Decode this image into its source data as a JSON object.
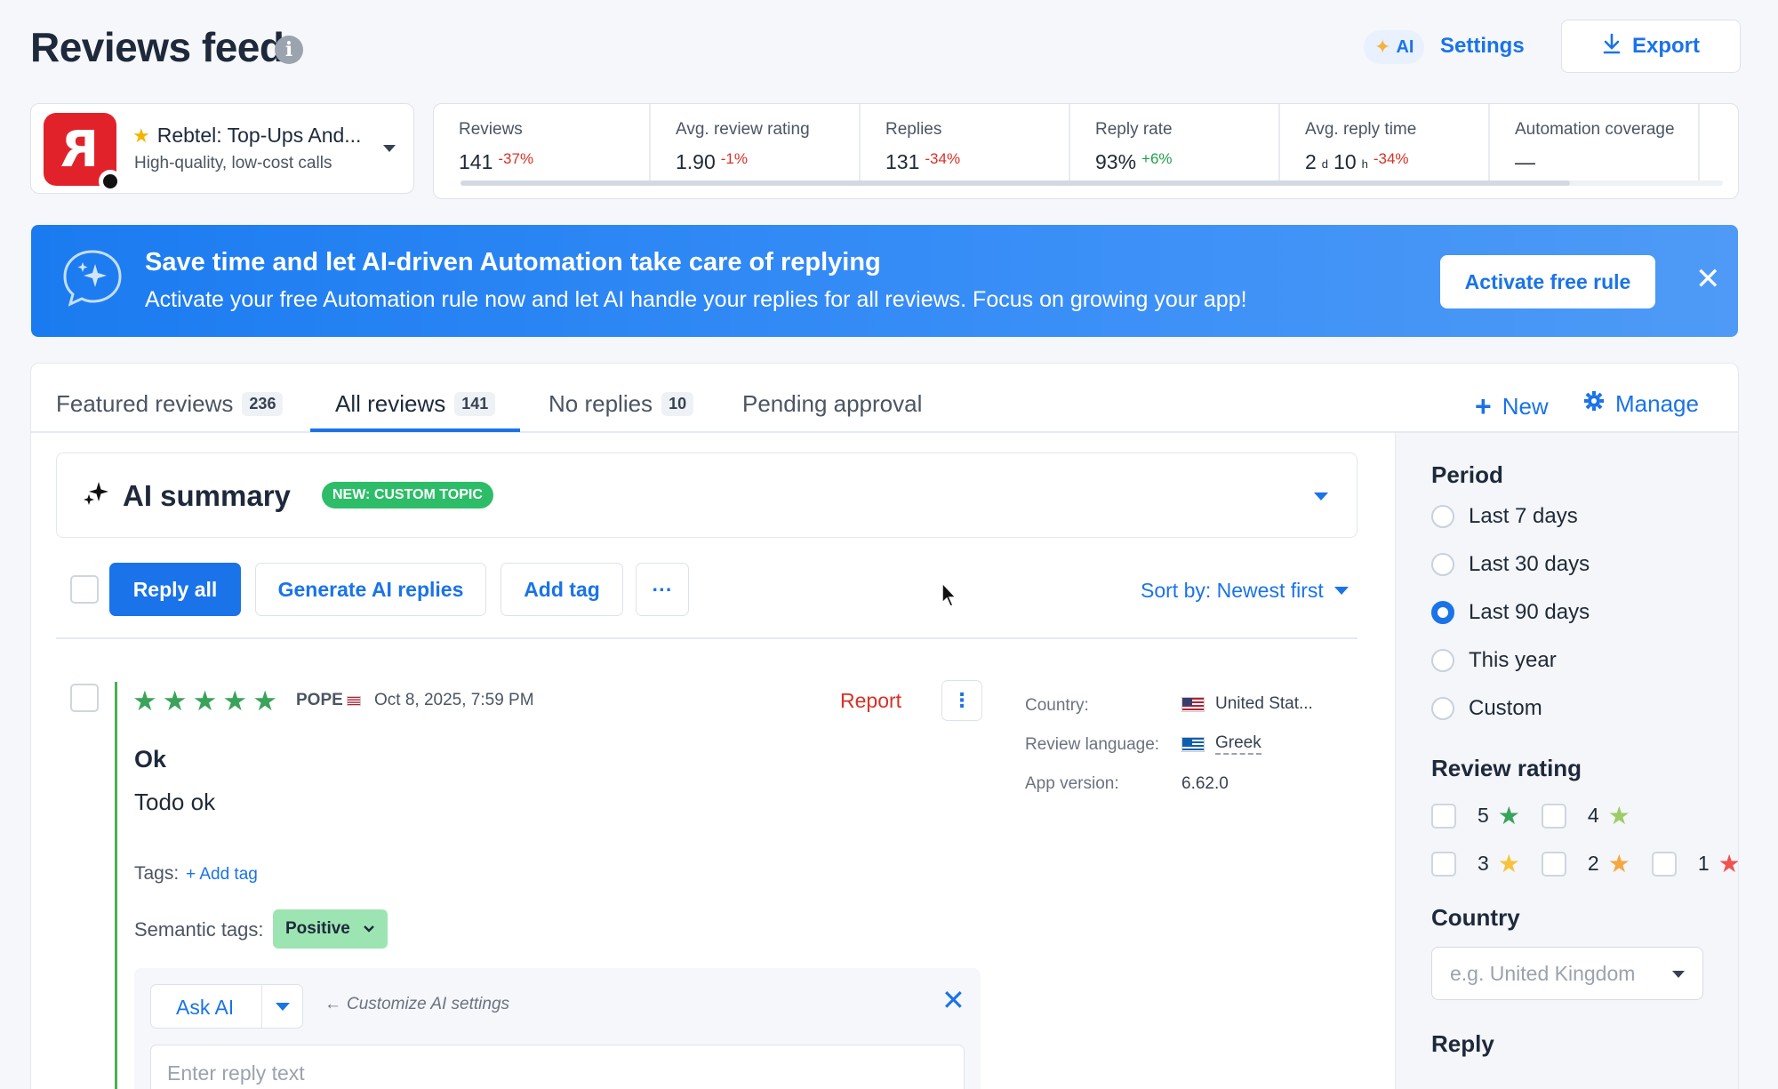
{
  "header": {
    "title": "Reviews feed",
    "ai_badge": "AI",
    "settings_label": "Settings",
    "export_label": "Export"
  },
  "app": {
    "name": "Rebtel: Top-Ups And...",
    "subtitle": "High-quality, low-cost calls"
  },
  "stats": [
    {
      "label": "Reviews",
      "value": "141",
      "delta": "-37%",
      "trend": "negative"
    },
    {
      "label": "Avg. review rating",
      "value": "1.90",
      "delta": "-1%",
      "trend": "negative"
    },
    {
      "label": "Replies",
      "value": "131",
      "delta": "-34%",
      "trend": "negative"
    },
    {
      "label": "Reply rate",
      "value": "93%",
      "delta": "+6%",
      "trend": "positive"
    },
    {
      "label": "Avg. reply time",
      "value_days": "2",
      "unit_days": "d",
      "value_hours": "10",
      "unit_hours": "h",
      "delta": "-34%",
      "trend": "negative"
    },
    {
      "label": "Automation coverage",
      "value": "—"
    }
  ],
  "banner": {
    "title": "Save time and let AI-driven Automation take care of replying",
    "text": "Activate your free Automation rule now and let AI handle your replies for all reviews. Focus on growing your app!",
    "button": "Activate free rule"
  },
  "tabs": [
    {
      "label": "Featured reviews",
      "count": "236"
    },
    {
      "label": "All reviews",
      "count": "141",
      "active": true
    },
    {
      "label": "No replies",
      "count": "10"
    },
    {
      "label": "Pending approval"
    }
  ],
  "tab_actions": {
    "new": "New",
    "manage": "Manage"
  },
  "ai_summary": {
    "title": "AI summary",
    "badge": "NEW: CUSTOM TOPIC"
  },
  "toolbar": {
    "reply_all": "Reply all",
    "generate": "Generate AI replies",
    "add_tag": "Add tag",
    "more": "···",
    "sort": "Sort by: Newest first"
  },
  "review": {
    "rating": 5,
    "author": "POPE",
    "date": "Oct 8, 2025, 7:59 PM",
    "report": "Report",
    "title": "Ok",
    "body": "Todo ok",
    "tags_label": "Tags:",
    "add_tag": "+ Add tag",
    "semantic_label": "Semantic tags:",
    "semantic_value": "Positive",
    "meta": {
      "country_label": "Country:",
      "country_value": "United Stat...",
      "language_label": "Review language:",
      "language_value": "Greek",
      "version_label": "App version:",
      "version_value": "6.62.0"
    },
    "reply": {
      "ask_ai": "Ask AI",
      "customize": "Customize AI settings",
      "placeholder": "Enter reply text"
    }
  },
  "sidebar": {
    "period_title": "Period",
    "periods": [
      {
        "label": "Last 7 days",
        "selected": false
      },
      {
        "label": "Last 30 days",
        "selected": false
      },
      {
        "label": "Last 90 days",
        "selected": true
      },
      {
        "label": "This year",
        "selected": false
      },
      {
        "label": "Custom",
        "selected": false
      }
    ],
    "rating_title": "Review rating",
    "ratings": [
      {
        "value": "5",
        "color": "#3aa35a"
      },
      {
        "value": "4",
        "color": "#9ccc65"
      },
      {
        "value": "3",
        "color": "#f9c23c"
      },
      {
        "value": "2",
        "color": "#f5a742"
      },
      {
        "value": "1",
        "color": "#ef5350"
      }
    ],
    "country_title": "Country",
    "country_placeholder": "e.g. United Kingdom",
    "reply_title": "Reply"
  },
  "colors": {
    "accent": "#1a73e8",
    "negative": "#d93025",
    "positive": "#1e9e4a",
    "review_bar": "#4caf50"
  }
}
